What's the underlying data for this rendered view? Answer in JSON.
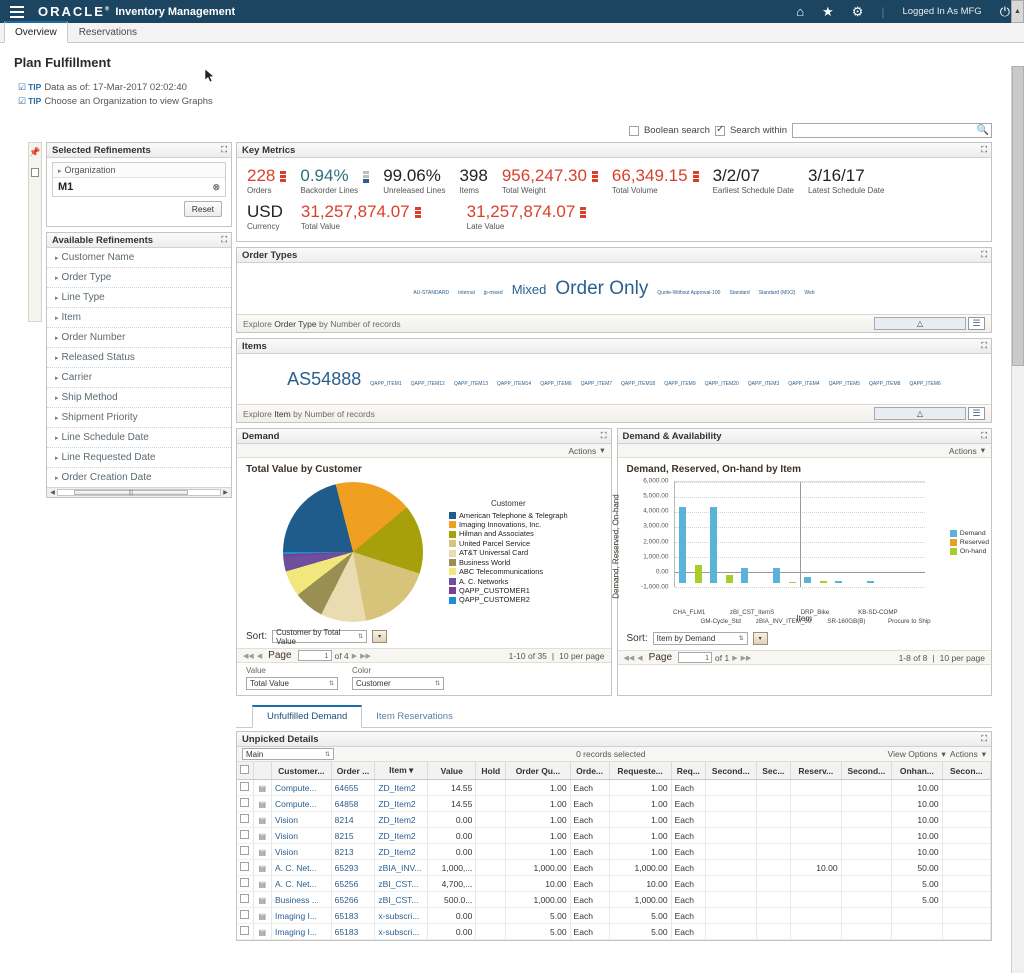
{
  "header": {
    "logo": "ORACLE",
    "logo_tm": "®",
    "app_title": "Inventory Management",
    "menu_icon": "hamburger-icon",
    "home_icon": "⌂",
    "favorites_icon": "★",
    "settings_icon": "⚙",
    "separator": "|",
    "user_text": "Logged In As MFG",
    "power_icon": "⏻"
  },
  "tabs": [
    {
      "label": "Overview",
      "active": true
    },
    {
      "label": "Reservations",
      "active": false
    }
  ],
  "page": {
    "title": "Plan Fulfillment",
    "tip_label": "TIP",
    "tips": [
      "Data as of: 17-Mar-2017 02:02:40",
      "Choose an Organization to view Graphs"
    ]
  },
  "search": {
    "boolean_label": "Boolean search",
    "within_label": "Search within",
    "value": "",
    "placeholder": "",
    "go_icon": "🔍"
  },
  "selected_refinements": {
    "title": "Selected Refinements",
    "group_label": "Organization",
    "value": "M1",
    "clear_icon": "⊗",
    "reset_label": "Reset"
  },
  "available_refinements": {
    "title": "Available Refinements",
    "items": [
      "Customer Name",
      "Order Type",
      "Line Type",
      "Item",
      "Order Number",
      "Released Status",
      "Carrier",
      "Ship Method",
      "Shipment Priority",
      "Line Schedule Date",
      "Line Requested Date",
      "Order Creation Date"
    ]
  },
  "key_metrics": {
    "title": "Key Metrics",
    "row1": [
      {
        "value": "228",
        "label": "Orders",
        "color": "red",
        "spark": "red"
      },
      {
        "value": "0.94%",
        "label": "Backorder Lines",
        "color": "teal",
        "spark": "blue"
      },
      {
        "value": "99.06%",
        "label": "Unreleased Lines",
        "color": "dark",
        "spark": "none"
      },
      {
        "value": "398",
        "label": "Items",
        "color": "dark",
        "spark": "none"
      },
      {
        "value": "956,247.30",
        "label": "Total Weight",
        "color": "red",
        "spark": "red"
      },
      {
        "value": "66,349.15",
        "label": "Total Volume",
        "color": "red",
        "spark": "red"
      },
      {
        "value": "3/2/07",
        "label": "Earliest Schedule Date",
        "color": "dark",
        "spark": "none"
      },
      {
        "value": "3/16/17",
        "label": "Latest Schedule Date",
        "color": "dark",
        "spark": "none"
      }
    ],
    "row2": [
      {
        "value": "USD",
        "label": "Currency",
        "color": "dark",
        "spark": "none"
      },
      {
        "value": "31,257,874.07",
        "label": "Total Value",
        "color": "red",
        "spark": "red"
      },
      {
        "value": "31,257,874.07",
        "label": "Late Value",
        "color": "red",
        "spark": "red"
      }
    ]
  },
  "order_types": {
    "title": "Order Types",
    "explore_prefix": "Explore",
    "explore_dim": "Order Type",
    "explore_by": "by Number of records",
    "cloud_icon": "cloud-view-icon",
    "list_icon": "list-view-icon",
    "tags": [
      {
        "text": "AU-STANDARD",
        "size": 5
      },
      {
        "text": "Internal",
        "size": 5
      },
      {
        "text": "jp-mixed",
        "size": 5
      },
      {
        "text": "Mixed",
        "size": 13
      },
      {
        "text": "Order Only",
        "size": 19
      },
      {
        "text": "Quote-Without Approval-100",
        "size": 5
      },
      {
        "text": "Standard",
        "size": 5
      },
      {
        "text": "Standard (MIX2)",
        "size": 5
      },
      {
        "text": "Web",
        "size": 5
      }
    ]
  },
  "items_cloud": {
    "title": "Items",
    "explore_prefix": "Explore",
    "explore_dim": "Item",
    "explore_by": "by Number of records",
    "tags": [
      {
        "text": "AS54888",
        "size": 18
      },
      {
        "text": "QAPP_ITEM1",
        "size": 5
      },
      {
        "text": "QAPP_ITEM12",
        "size": 5
      },
      {
        "text": "QAPP_ITEM13",
        "size": 5
      },
      {
        "text": "QAPP_ITEM14",
        "size": 5
      },
      {
        "text": "QAPP_ITEM6",
        "size": 5
      },
      {
        "text": "QAPP_ITEM7",
        "size": 5
      },
      {
        "text": "QAPP_ITEM18",
        "size": 5
      },
      {
        "text": "QAPP_ITEM9",
        "size": 5
      },
      {
        "text": "QAPP_ITEM20",
        "size": 5
      },
      {
        "text": "QAPP_ITEM3",
        "size": 5
      },
      {
        "text": "QAPP_ITEM4",
        "size": 5
      },
      {
        "text": "QAPP_ITEM5",
        "size": 5
      },
      {
        "text": "QAPP_ITEM8",
        "size": 5
      },
      {
        "text": "QAPP_ITEM6",
        "size": 5
      }
    ]
  },
  "demand_panel": {
    "title": "Demand",
    "actions_label": "Actions",
    "sort_label": "Sort:",
    "sort_value": "Customer by Total Value",
    "page_label": "Page",
    "page_value": "1",
    "page_of": "of 4",
    "range": "1-10 of 35",
    "per_page": "10 per page",
    "value_label": "Value",
    "value_select": "Total Value",
    "color_label": "Color",
    "color_select": "Customer"
  },
  "availability_panel": {
    "title": "Demand & Availability",
    "actions_label": "Actions",
    "sort_label": "Sort:",
    "sort_value": "Item by Demand",
    "page_label": "Page",
    "page_value": "1",
    "page_of": "of 1",
    "range": "1-8 of 8",
    "per_page": "10 per page"
  },
  "chart_data": [
    {
      "type": "pie",
      "title": "Total Value by Customer",
      "legend_title": "Customer",
      "legend_position": "right",
      "categories": [
        "American Telephone & Telegraph",
        "Imaging Innovations, Inc.",
        "Hilman and Associates",
        "United Parcel Service",
        "AT&T Universal Card",
        "Business World",
        "ABC Telecommunications",
        "A. C. Networks",
        "QAPP_CUSTOMER1",
        "QAPP_CUSTOMER2"
      ],
      "values": [
        21.0,
        18.0,
        16.0,
        17.0,
        10.5,
        7.0,
        6.0,
        3.4,
        0.6,
        0.5
      ],
      "colors": [
        "#1f5c8b",
        "#f0a020",
        "#a8a00a",
        "#d8c37a",
        "#e8dcb0",
        "#9a8f52",
        "#f2e77c",
        "#6e4f9e",
        "#7a3f8f",
        "#1a8fd8"
      ]
    },
    {
      "type": "bar",
      "title": "Demand, Reserved, On-hand by Item",
      "xlabel": "Item",
      "ylabel": "Demand, Reserved, On-hand",
      "ylim": [
        -1000,
        6000
      ],
      "yticks": [
        "6,000.00",
        "5,000.00",
        "4,000.00",
        "3,000.00",
        "2,000.00",
        "1,000.00",
        "0.00",
        "-1,000.00"
      ],
      "categories": [
        "CHA_FLM1",
        "GM-Cycle_Std",
        "zBI_CST_ItemS",
        "zBIA_INV_ITEM_09",
        "DRP_Bike",
        "SR-160GB(B)",
        "KB-SD-COMP",
        "Procure to Ship"
      ],
      "series": [
        {
          "name": "Demand",
          "color": "#5cb3d9",
          "values": [
            5030,
            5030,
            1000,
            1000,
            400,
            120,
            80,
            0
          ]
        },
        {
          "name": "Reserved",
          "color": "#e8a020",
          "values": [
            0,
            0,
            0,
            0,
            0,
            0,
            0,
            0
          ]
        },
        {
          "name": "On-hand",
          "color": "#a8cc2a",
          "values": [
            1200,
            520,
            0,
            60,
            90,
            0,
            0,
            0
          ]
        }
      ],
      "legend_position": "right"
    }
  ],
  "bottom_tabs": [
    {
      "label": "Unfulfilled Demand",
      "active": true
    },
    {
      "label": "Item Reservations",
      "active": false
    }
  ],
  "unpicked": {
    "title": "Unpicked Details",
    "view_select": "Main",
    "records_selected": "0 records selected",
    "view_options_label": "View Options",
    "actions_label": "Actions",
    "columns": [
      "Customer...",
      "Order ...",
      "Item",
      "Value",
      "Hold",
      "Order Qu...",
      "Orde...",
      "Requeste...",
      "Req...",
      "Second...",
      "Sec...",
      "Reserv...",
      "Second...",
      "Onhan...",
      "Secon..."
    ],
    "sort_col_index": 2,
    "sort_icon": "▾",
    "rows": [
      {
        "customer": "Compute...",
        "order": "64655",
        "item": "ZD_Item2",
        "value": "14.55",
        "hold": "",
        "oq": "1.00",
        "ou": "Each",
        "rq": "1.00",
        "ru": "Each",
        "s1": "",
        "s2": "",
        "res": "",
        "s3": "",
        "onhand": "10.00",
        "s4": ""
      },
      {
        "customer": "Compute...",
        "order": "64858",
        "item": "ZD_Item2",
        "value": "14.55",
        "hold": "",
        "oq": "1.00",
        "ou": "Each",
        "rq": "1.00",
        "ru": "Each",
        "s1": "",
        "s2": "",
        "res": "",
        "s3": "",
        "onhand": "10.00",
        "s4": ""
      },
      {
        "customer": "Vision",
        "order": "8214",
        "item": "ZD_Item2",
        "value": "0.00",
        "hold": "",
        "oq": "1.00",
        "ou": "Each",
        "rq": "1.00",
        "ru": "Each",
        "s1": "",
        "s2": "",
        "res": "",
        "s3": "",
        "onhand": "10.00",
        "s4": ""
      },
      {
        "customer": "Vision",
        "order": "8215",
        "item": "ZD_Item2",
        "value": "0.00",
        "hold": "",
        "oq": "1.00",
        "ou": "Each",
        "rq": "1.00",
        "ru": "Each",
        "s1": "",
        "s2": "",
        "res": "",
        "s3": "",
        "onhand": "10.00",
        "s4": ""
      },
      {
        "customer": "Vision",
        "order": "8213",
        "item": "ZD_Item2",
        "value": "0.00",
        "hold": "",
        "oq": "1.00",
        "ou": "Each",
        "rq": "1.00",
        "ru": "Each",
        "s1": "",
        "s2": "",
        "res": "",
        "s3": "",
        "onhand": "10.00",
        "s4": ""
      },
      {
        "customer": "A. C. Net...",
        "order": "65293",
        "item": "zBIA_INV...",
        "value": "1,000,...",
        "hold": "",
        "oq": "1,000.00",
        "ou": "Each",
        "rq": "1,000.00",
        "ru": "Each",
        "s1": "",
        "s2": "",
        "res": "10.00",
        "s3": "",
        "onhand": "50.00",
        "s4": ""
      },
      {
        "customer": "A. C. Net...",
        "order": "65256",
        "item": "zBI_CST...",
        "value": "4,700,...",
        "hold": "",
        "oq": "10.00",
        "ou": "Each",
        "rq": "10.00",
        "ru": "Each",
        "s1": "",
        "s2": "",
        "res": "",
        "s3": "",
        "onhand": "5.00",
        "s4": ""
      },
      {
        "customer": "Business ...",
        "order": "65266",
        "item": "zBI_CST...",
        "value": "500.0...",
        "hold": "",
        "oq": "1,000.00",
        "ou": "Each",
        "rq": "1,000.00",
        "ru": "Each",
        "s1": "",
        "s2": "",
        "res": "",
        "s3": "",
        "onhand": "5.00",
        "s4": ""
      },
      {
        "customer": "Imaging I...",
        "order": "65183",
        "item": "x-subscri...",
        "value": "0.00",
        "hold": "",
        "oq": "5.00",
        "ou": "Each",
        "rq": "5.00",
        "ru": "Each",
        "s1": "",
        "s2": "",
        "res": "",
        "s3": "",
        "onhand": "",
        "s4": ""
      },
      {
        "customer": "Imaging I...",
        "order": "65183",
        "item": "x-subscri...",
        "value": "0.00",
        "hold": "",
        "oq": "5.00",
        "ou": "Each",
        "rq": "5.00",
        "ru": "Each",
        "s1": "",
        "s2": "",
        "res": "",
        "s3": "",
        "onhand": "",
        "s4": ""
      }
    ]
  },
  "colors": {
    "header_bg": "#1b4561",
    "accent_blue": "#2a5f8f",
    "metric_red": "#d9402b",
    "tab_active": "#1b6ca8"
  }
}
